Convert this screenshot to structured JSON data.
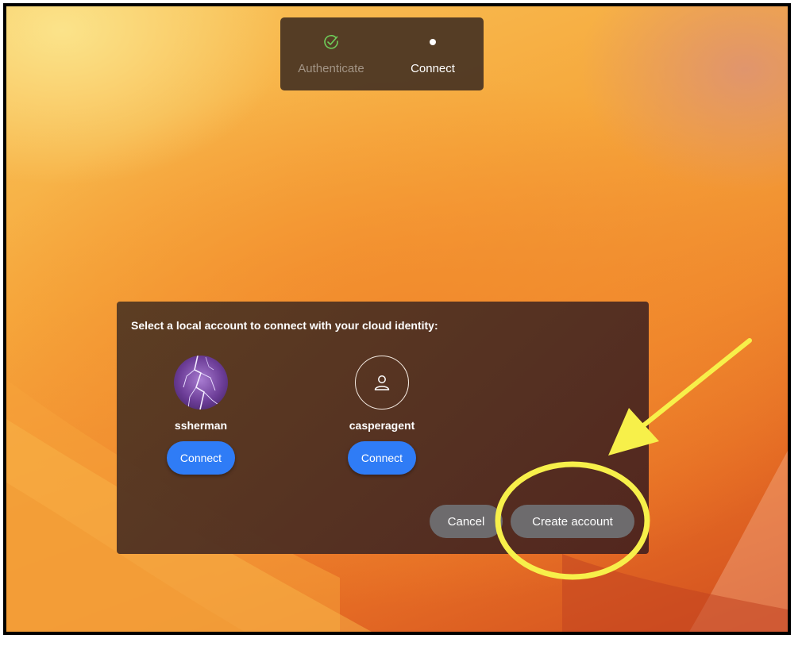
{
  "steps": [
    {
      "label": "Authenticate",
      "state": "done",
      "icon": "check-circle-icon",
      "color": "#a39586"
    },
    {
      "label": "Connect",
      "state": "current",
      "icon": "dot-icon",
      "color": "#ffffff"
    }
  ],
  "dialog": {
    "prompt": "Select a local account to connect with your cloud identity:",
    "accounts": [
      {
        "name": "ssherman",
        "avatar": "lightning-photo-avatar",
        "button": "Connect"
      },
      {
        "name": "casperagent",
        "avatar": "person-icon",
        "button": "Connect"
      }
    ],
    "cancel_label": "Cancel",
    "create_label": "Create account"
  },
  "annotation": {
    "color": "#f7f04a",
    "shapes": [
      "highlight-ellipse",
      "pointer-arrow"
    ]
  },
  "colors": {
    "primary_button": "#2f7cf6",
    "secondary_button": "#6d6b6d",
    "success_check": "#6fcf5a"
  }
}
